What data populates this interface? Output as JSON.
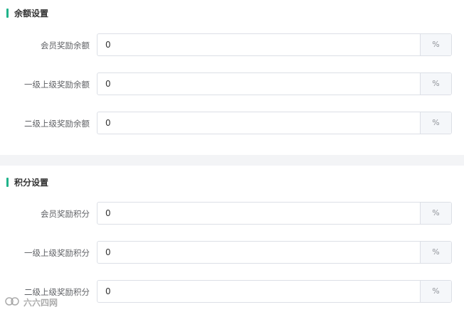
{
  "balance_section": {
    "title": "余额设置",
    "rows": [
      {
        "label": "会员奖励余额",
        "value": "0",
        "suffix": "%"
      },
      {
        "label": "一级上级奖励余额",
        "value": "0",
        "suffix": "%"
      },
      {
        "label": "二级上级奖励余额",
        "value": "0",
        "suffix": "%"
      }
    ]
  },
  "points_section": {
    "title": "积分设置",
    "rows": [
      {
        "label": "会员奖励积分",
        "value": "0",
        "suffix": "%"
      },
      {
        "label": "一级上级奖励积分",
        "value": "0",
        "suffix": "%"
      },
      {
        "label": "二级上级奖励积分",
        "value": "0",
        "suffix": "%"
      }
    ]
  },
  "watermark": {
    "text": "六六四网"
  },
  "colors": {
    "accent": "#1fb38a",
    "border": "#dcdfe6",
    "suffix_bg": "#f5f7fa"
  }
}
